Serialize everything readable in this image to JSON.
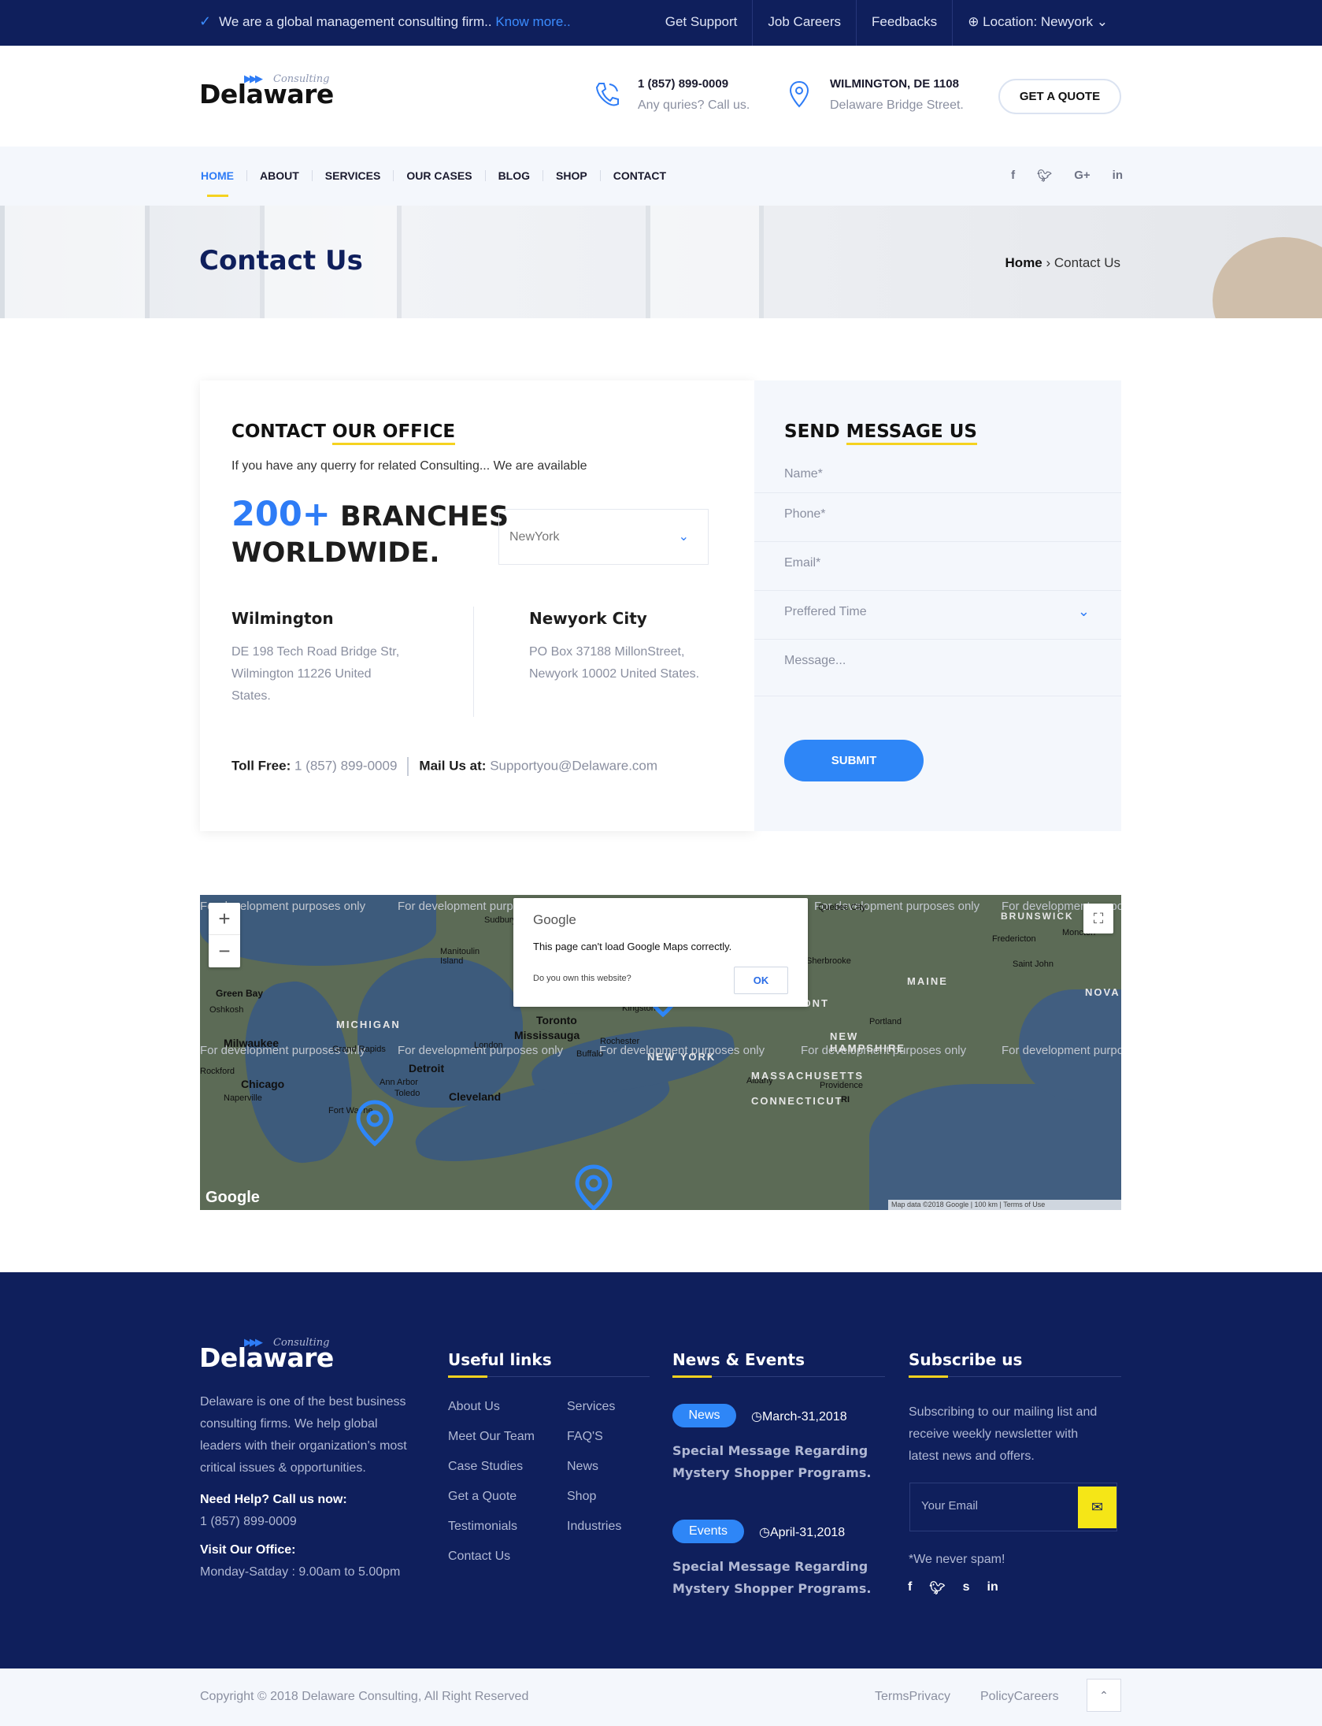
{
  "topbar": {
    "message": "We are a global management consulting firm..",
    "know_more": "Know more..",
    "links": [
      "Get Support",
      "Job Careers",
      "Feedbacks",
      "Location: Newyork"
    ]
  },
  "header": {
    "logo_small": "Consulting",
    "logo_name": "Delaware",
    "phone": "1 (857) 899-0009",
    "phone_sub": "Any quries? Call us.",
    "address": "WILMINGTON, DE 1108",
    "address_sub": "Delaware Bridge Street.",
    "quote_button": "GET A QUOTE"
  },
  "nav": {
    "items": [
      "HOME",
      "ABOUT",
      "SERVICES",
      "OUR CASES",
      "BLOG",
      "SHOP",
      "CONTACT"
    ],
    "social": [
      "f",
      "t",
      "G+",
      "in"
    ]
  },
  "banner": {
    "title": "Contact Us",
    "crumb_home": "Home",
    "crumb_current": "Contact Us"
  },
  "contact": {
    "title_a": "CONTACT",
    "title_b": "OUR OFFICE",
    "intro": "If you have any querry for related Consulting... We are available",
    "branches_num": "200+",
    "branches_a": "BRANCHES",
    "branches_b": "WORLDWIDE.",
    "select_value": "NewYork",
    "offices": [
      {
        "name": "Wilmington",
        "addr1": "DE 198 Tech Road Bridge Str,",
        "addr2": "Wilmington 11226 United",
        "addr3": "States."
      },
      {
        "name": "Newyork City",
        "addr1": "PO Box 37188 MillonStreet,",
        "addr2": "Newyork 10002 United States."
      }
    ],
    "toll_label": "Toll Free:",
    "toll_value": "1 (857) 899-0009",
    "mail_label": "Mail Us at:",
    "mail_value": "Supportyou@Delaware.com"
  },
  "form": {
    "title_a": "SEND",
    "title_b": "MESSAGE US",
    "name": "Name*",
    "phone": "Phone*",
    "email": "Email*",
    "time": "Preffered Time",
    "message": "Message...",
    "submit": "SUBMIT"
  },
  "map": {
    "watermark": "For development purposes only",
    "dialog_brand": "Google",
    "dialog_message": "This page can't load Google Maps correctly.",
    "dialog_question": "Do you own this website?",
    "dialog_ok": "OK",
    "google": "Google",
    "footer": "Map data ©2018 Google | 100 km | Terms of Use",
    "labels": [
      "Sudbury",
      "Manitoulin Island",
      "Green Bay",
      "Oshkosh",
      "MICHIGAN",
      "Milwaukee",
      "Grand Rapids",
      "Chicago",
      "Naperville",
      "Fort Wayne",
      "Ann Arbor",
      "Detroit",
      "Toledo",
      "Cleveland",
      "London",
      "Toronto",
      "Mississauga",
      "Buffalo",
      "Rochester",
      "NEW YORK",
      "Kingston",
      "Albany",
      "VERMONT",
      "MAINE",
      "NEW HAMPSHIRE",
      "MASSACHUSETTS",
      "CONNECTICUT",
      "Providence",
      "Portland",
      "Sherbrooke",
      "Quebec City",
      "BRUNSWICK",
      "Fredericton",
      "Moncton",
      "Saint John",
      "NOVA",
      "RI",
      "Rockford"
    ]
  },
  "footer": {
    "logo_small": "Consulting",
    "logo_name": "Delaware",
    "about": [
      "Delaware is one of the best business",
      "consulting firms. We help global",
      "leaders with their organization's most",
      "critical issues & opportunities."
    ],
    "help_label": "Need Help? Call us now:",
    "help_phone": "1 (857) 899-0009",
    "office_label": "Visit Our Office:",
    "office_hours": "Monday-Satday : 9.00am to 5.00pm",
    "links_title": "Useful links",
    "links_col1": [
      "About Us",
      "Meet Our Team",
      "Case Studies",
      "Get a Quote",
      "Testimonials",
      "Contact Us"
    ],
    "links_col2": [
      "Services",
      "FAQ'S",
      "News",
      "Shop",
      "Industries"
    ],
    "news_title": "News & Events",
    "news": [
      {
        "badge": "News",
        "date": "March-31,2018",
        "l1": "Special Message Regarding",
        "l2": "Mystery Shopper Programs."
      },
      {
        "badge": "Events",
        "date": "April-31,2018",
        "l1": "Special Message Regarding",
        "l2": "Mystery Shopper Programs."
      }
    ],
    "sub_title": "Subscribe us",
    "sub_text": [
      "Subscribing to our mailing list and",
      "receive weekly newsletter with",
      "latest news and offers."
    ],
    "email_placeholder": "Your Email",
    "no_spam": "*We never spam!",
    "social": [
      "f",
      "t",
      "s",
      "in"
    ]
  },
  "bottom": {
    "copyright": "Copyright © 2018 Delaware Consulting, All Right Reserved",
    "links": [
      "TermsPrivacy",
      "PolicyCareers"
    ]
  },
  "colors": {
    "navy": "#0f1f5c",
    "accent": "#2e7cf6",
    "yellow": "#f5d21f"
  }
}
